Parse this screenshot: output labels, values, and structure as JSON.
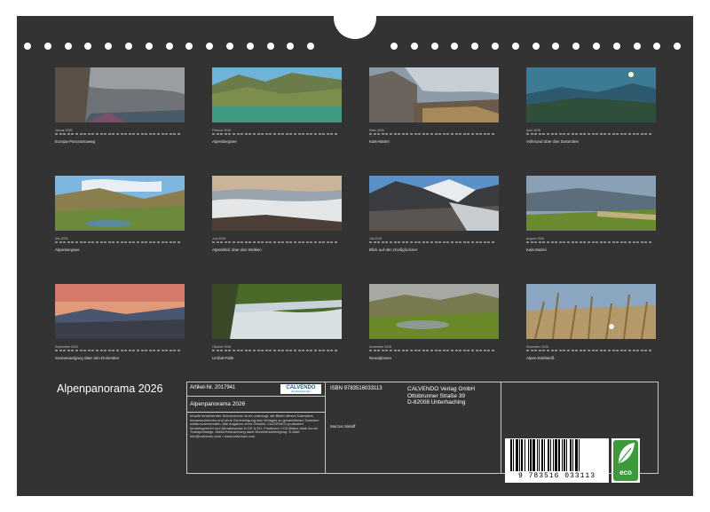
{
  "calendar": {
    "title": "Alpenpanorama 2026",
    "months": [
      {
        "label": "Januar 2026",
        "caption": "Europa-Panoramaweg",
        "photo": "mountain-cliff-storm-clouds"
      },
      {
        "label": "Februar 2026",
        "caption": "Alpenbergsee",
        "photo": "alpine-lake-green-slopes"
      },
      {
        "label": "März 2026",
        "caption": "Kals-Matrei",
        "photo": "stone-hut-valley-clouds"
      },
      {
        "label": "April 2026",
        "caption": "Vollmond über den Dolomiten",
        "photo": "moonlit-dolomites"
      },
      {
        "label": "Mai 2026",
        "caption": "Alpenbergsee",
        "photo": "green-valley-lake"
      },
      {
        "label": "Juni 2026",
        "caption": "Alpenblick über den Wolken",
        "photo": "above-the-clouds"
      },
      {
        "label": "Juli 2026",
        "caption": "Blick auf den Großglockner",
        "photo": "grossglockner-glacier"
      },
      {
        "label": "August 2026",
        "caption": "Kals-Matrei",
        "photo": "meadow-flowers-valley"
      },
      {
        "label": "September 2026",
        "caption": "Sonnenaufgang über den Dolomiten",
        "photo": "sunrise-dolomites"
      },
      {
        "label": "Oktober 2026",
        "caption": "Umbal-Fälle",
        "photo": "umbal-waterfalls"
      },
      {
        "label": "November 2026",
        "caption": "Neualplseen",
        "photo": "neualpl-lakes"
      },
      {
        "label": "Dezember 2026",
        "caption": "Alpen-Edelweiß",
        "photo": "edelweiss-grass"
      }
    ]
  },
  "info": {
    "article_no": "Artikel-Nr. 2017941",
    "publisher_logo": "CALVENDO",
    "publisher_logo_sub": "Die Kalendermarke",
    "book_title": "Alpenpanorama 2026",
    "legal_text": "Inhalte bestehender Schutzrechte ist es untersagt, die Bilder dieses Kalenders herauszutrennen und ohne Genehmigung des Verlages zu gewerblichen Zwecken weiterzuverwenden. Alle Angaben ohne Gewähr. CALVENDO produziert bedarfsgerecht und klimabewusst in DE & EU. Positivere CO2-Bilanz dank kurzer Transportwege. Abfall-Reduzierung dank Einzelstückfertigung. E-Mail: info@calvendo.com • www.calvendo.com",
    "isbn": "ISBN 9783516033113",
    "publisher_line1": "CALVENDO Verlag GmbH",
    "publisher_line2": "Ottobrunner Straße 39",
    "publisher_line3": "D-82008 Unterhaching",
    "author": "Marcus Sielaff",
    "barcode_digits": "9 783516 033113",
    "eco_label": "eco"
  }
}
